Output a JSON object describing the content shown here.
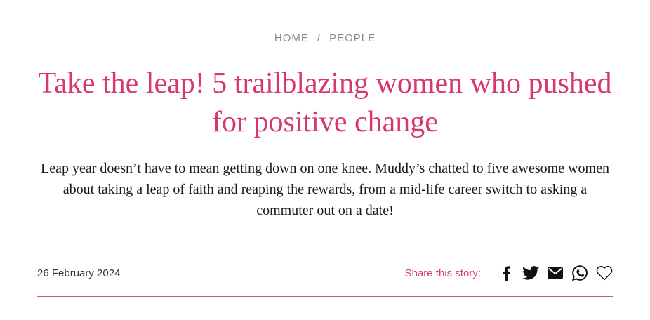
{
  "breadcrumb": {
    "home": "HOME",
    "separator": "/",
    "section": "PEOPLE"
  },
  "article": {
    "title": "Take the leap! 5 trailblazing women who pushed for positive change",
    "standfirst": "Leap year doesn’t have to mean getting down on one knee. Muddy’s chatted to five awesome women about taking a leap of faith and reaping the rewards, from a mid-life career switch to asking a commuter out on a date!",
    "date": "26 February 2024"
  },
  "share": {
    "label": "Share this story:",
    "icons": [
      "facebook-icon",
      "twitter-icon",
      "email-icon",
      "whatsapp-icon",
      "heart-icon"
    ]
  },
  "colors": {
    "accent": "#d8366c",
    "rule": "#c9558b",
    "breadcrumb": "#8a8a8a",
    "text": "#1a1a1a"
  }
}
